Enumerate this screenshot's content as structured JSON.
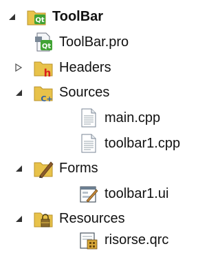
{
  "tree": {
    "root": {
      "label": "ToolBar",
      "expanded": true,
      "icon": "qt-project-folder-icon"
    },
    "project_file": {
      "label": "ToolBar.pro",
      "icon": "qt-pro-file-icon"
    },
    "headers": {
      "label": "Headers",
      "expanded": false,
      "icon": "headers-folder-icon"
    },
    "sources": {
      "label": "Sources",
      "expanded": true,
      "icon": "sources-folder-icon",
      "files": [
        {
          "label": "main.cpp",
          "icon": "cpp-file-icon"
        },
        {
          "label": "toolbar1.cpp",
          "icon": "cpp-file-icon"
        }
      ]
    },
    "forms": {
      "label": "Forms",
      "expanded": true,
      "icon": "forms-folder-icon",
      "files": [
        {
          "label": "toolbar1.ui",
          "icon": "ui-form-file-icon"
        }
      ]
    },
    "resources": {
      "label": "Resources",
      "expanded": true,
      "icon": "resources-folder-icon",
      "files": [
        {
          "label": "risorse.qrc",
          "icon": "qrc-file-icon"
        }
      ]
    }
  },
  "colors": {
    "folder_yellow": "#e8c24a",
    "qt_green": "#41a334",
    "headers_red": "#d9201b",
    "cpp_blue": "#2b5fa8"
  }
}
